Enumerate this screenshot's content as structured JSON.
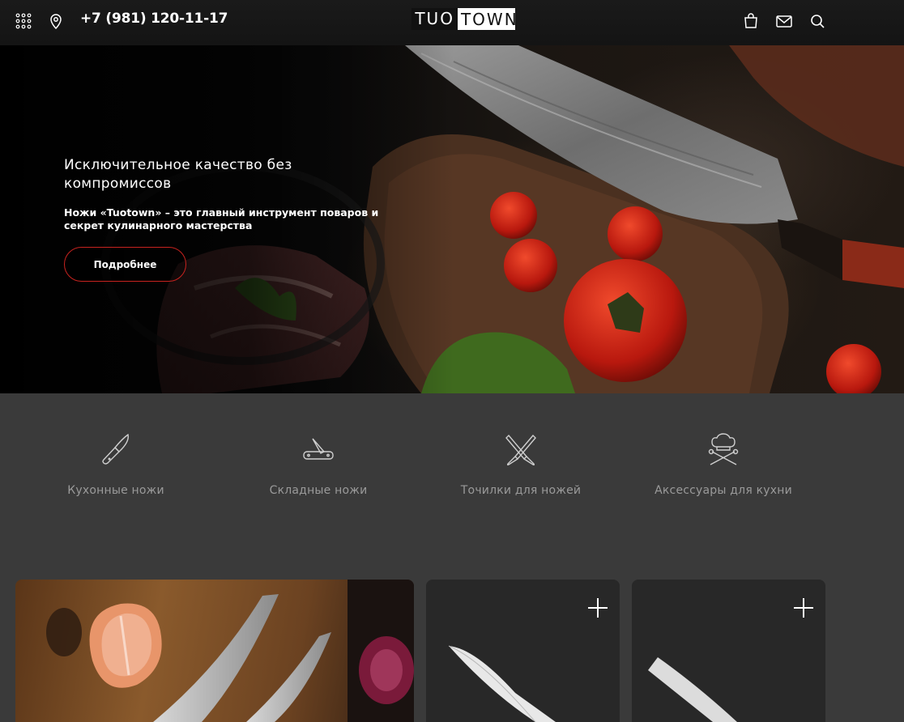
{
  "header": {
    "phone": "+7 (981) 120-11-17",
    "logo_part1": "TUO",
    "logo_part2": "TOWN",
    "icons": [
      "grid-menu-icon",
      "location-pin-icon",
      "bag-icon",
      "mail-icon",
      "search-icon"
    ]
  },
  "hero": {
    "title": "Исключительное качество без компромиссов",
    "subtitle": "Ножи «Tuotown» – это главный инструмент поваров и секрет кулинарного мастерства",
    "button_label": "Подробнее"
  },
  "categories": [
    {
      "label": "Кухонные ножи",
      "icon": "kitchen-knife-icon"
    },
    {
      "label": "Складные ножи",
      "icon": "folding-knife-icon"
    },
    {
      "label": "Точилки для ножей",
      "icon": "knife-sharpener-icon"
    },
    {
      "label": "Аксессуары для кухни",
      "icon": "chef-hat-icon"
    }
  ],
  "colors": {
    "accent": "#c8231f",
    "header_bg": "#161616",
    "section_bg": "#3a3a3a",
    "card_bg": "#282828"
  }
}
